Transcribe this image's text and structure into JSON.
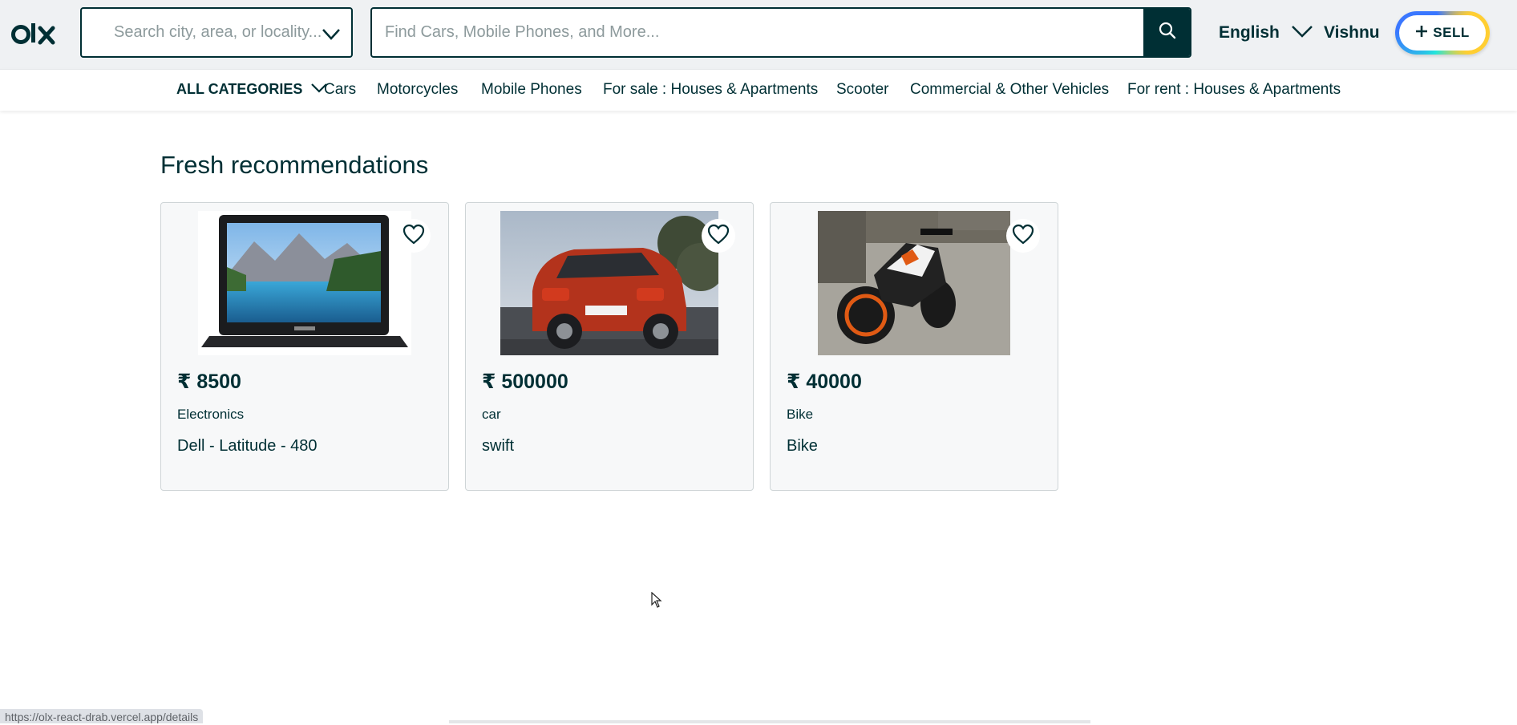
{
  "header": {
    "logo_text": "olx",
    "location_placeholder": "Search city, area, or locality...",
    "search_placeholder": "Find Cars, Mobile Phones, and More...",
    "language": "English",
    "user": "Vishnu",
    "sell_label": "SELL"
  },
  "categories": {
    "all_label": "ALL CATEGORIES",
    "items": [
      "Cars",
      "Motorcycles",
      "Mobile Phones",
      "For sale : Houses & Apartments",
      "Scooter",
      "Commercial & Other Vehicles",
      "For rent : Houses & Apartments"
    ]
  },
  "main": {
    "section_title": "Fresh recommendations",
    "cards": [
      {
        "price": "₹ 8500",
        "category": "Electronics",
        "title": "Dell - Latitude - 480",
        "image": "laptop"
      },
      {
        "price": "₹ 500000",
        "category": "car",
        "title": "swift",
        "image": "red-hatchback-car"
      },
      {
        "price": "₹ 40000",
        "category": "Bike",
        "title": "Bike",
        "image": "motorcycle"
      }
    ]
  },
  "status_bar": {
    "url": "https://olx-react-drab.vercel.app/details"
  },
  "colors": {
    "primary": "#002f34",
    "header_bg": "#eff1f3",
    "card_bg": "#f7f8f9"
  }
}
